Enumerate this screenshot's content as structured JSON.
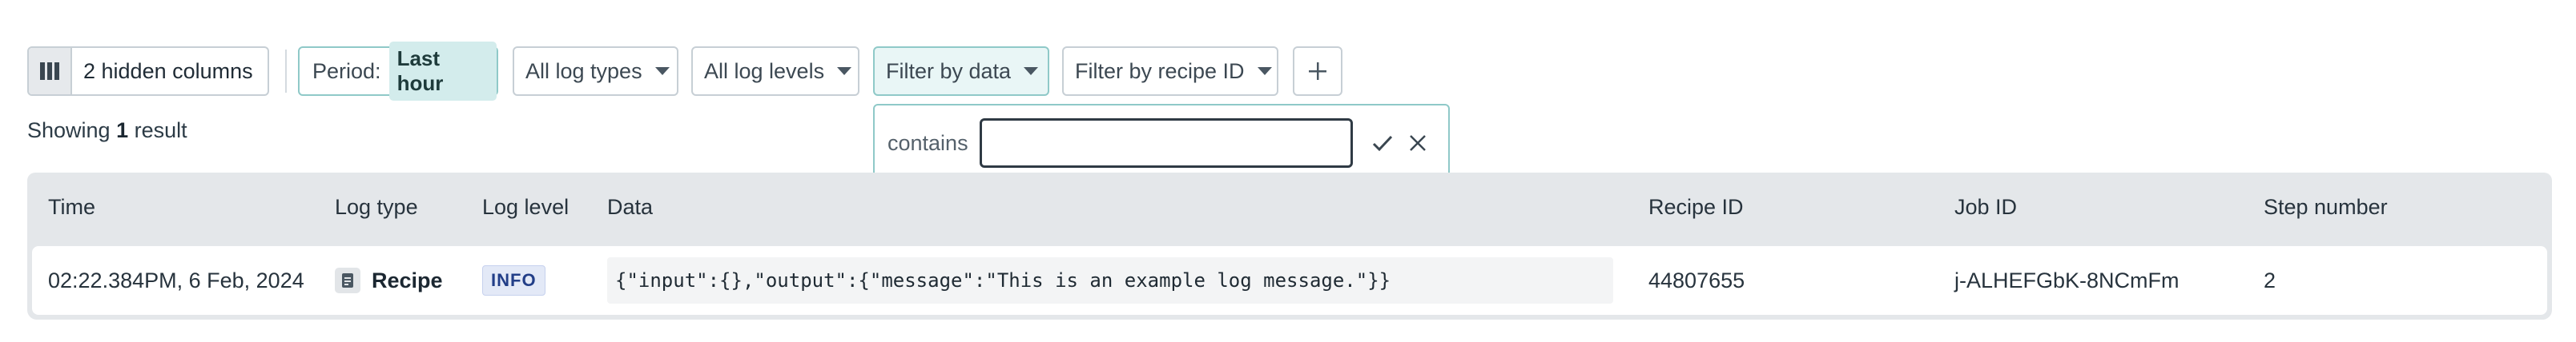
{
  "toolbar": {
    "hidden_columns_label": "2 hidden columns",
    "period_prefix": "Period:",
    "period_value": "Last hour",
    "log_types_label": "All log types",
    "log_levels_label": "All log levels",
    "filter_data_label": "Filter by data",
    "filter_recipe_label": "Filter by recipe ID",
    "add_filter_icon": "plus-icon",
    "columns_icon": "columns-icon"
  },
  "popover": {
    "operator_label": "contains",
    "input_value": "",
    "input_placeholder": "",
    "confirm_icon": "check-icon",
    "clear_icon": "close-icon"
  },
  "results": {
    "showing_prefix": "Showing",
    "count": "1",
    "showing_suffix": "result"
  },
  "table": {
    "columns": [
      "Time",
      "Log type",
      "Log level",
      "Data",
      "Recipe ID",
      "Job ID",
      "Step number"
    ],
    "rows": [
      {
        "time": "02:22.384PM, 6 Feb, 2024",
        "log_type": "Recipe",
        "log_type_icon": "document-icon",
        "log_level": "INFO",
        "data": "{\"input\":{},\"output\":{\"message\":\"This is an example log message.\"}}",
        "recipe_id": "44807655",
        "job_id": "j-ALHEFGbK-8NCmFm",
        "step_number": "2"
      }
    ]
  },
  "colors": {
    "accent_border": "#8fc9c8",
    "accent_bg": "#d3ecec",
    "header_bg": "#e4e7ea",
    "info_badge_bg": "#e3e9f7",
    "info_badge_text": "#223e88"
  }
}
